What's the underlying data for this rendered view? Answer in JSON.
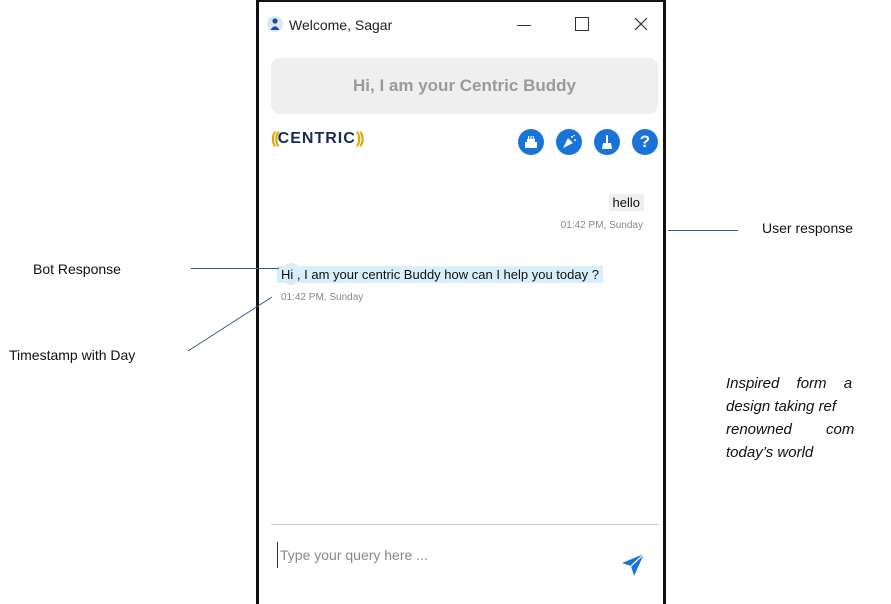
{
  "window": {
    "title": "Welcome, Sagar",
    "close_glyph": "✕"
  },
  "banner": {
    "text": "Hi, I am your Centric Buddy"
  },
  "brand": {
    "open": "((",
    "name": "CENTRIC",
    "close": "))",
    "colors": {
      "text": "#1b2b55",
      "parens": "#e3a300"
    }
  },
  "toolbar": {
    "icons": [
      "cake-icon",
      "party-popper-icon",
      "broom-icon",
      "help-icon"
    ],
    "help_glyph": "?",
    "accent": "#1a73d8"
  },
  "chat": {
    "user_message": "hello",
    "user_time": "01:42 PM, Sunday",
    "bot_message": "Hi , I am your centric Buddy how can I help you today ?",
    "bot_time": "01:42 PM, Sunday",
    "bot_bubble_color": "#d9eefb",
    "user_bubble_color": "#efefef"
  },
  "input": {
    "placeholder": "Type your query here ..."
  },
  "annotations": {
    "user_response": "User response",
    "bot_response": "Bot Response",
    "timestamp": "Timestamp with Day"
  },
  "quote": {
    "line1": "Inspired form a",
    "line2": "design taking ref",
    "line3": "renowned com",
    "line4": "today’s world"
  }
}
